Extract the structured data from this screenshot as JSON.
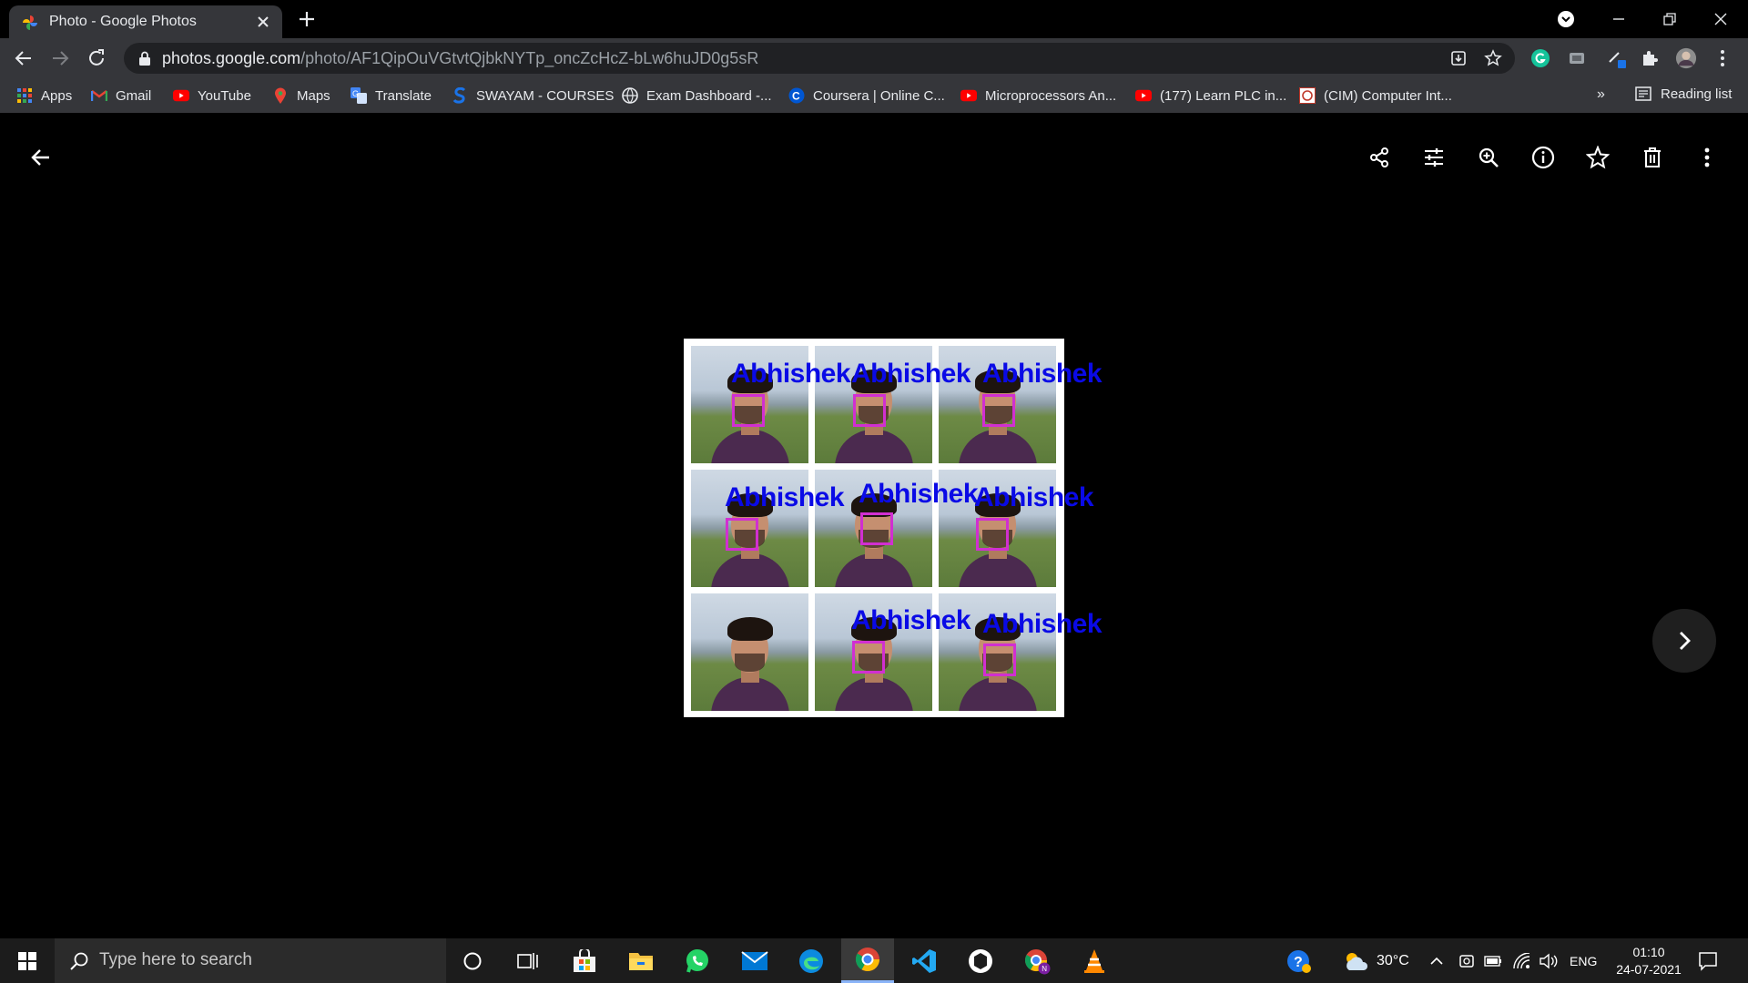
{
  "browser": {
    "tab_title": "Photo - Google Photos",
    "url_domain": "photos.google.com",
    "url_path": "/photo/AF1QipOuVGtvtQjbkNYTp_oncZcHcZ-bLw6huJD0g5sR"
  },
  "bookmarks": [
    {
      "label": "Apps",
      "icon": "apps-grid-icon"
    },
    {
      "label": "Gmail",
      "icon": "gmail-icon"
    },
    {
      "label": "YouTube",
      "icon": "youtube-icon"
    },
    {
      "label": "Maps",
      "icon": "maps-icon"
    },
    {
      "label": "Translate",
      "icon": "translate-icon"
    },
    {
      "label": "SWAYAM - COURSES",
      "icon": "swayam-icon"
    },
    {
      "label": "Exam Dashboard -...",
      "icon": "globe-icon"
    },
    {
      "label": "Coursera | Online C...",
      "icon": "coursera-icon"
    },
    {
      "label": "Microprocessors An...",
      "icon": "youtube-icon"
    },
    {
      "label": "(177) Learn PLC in...",
      "icon": "youtube-icon"
    },
    {
      "label": "(CIM) Computer Int...",
      "icon": "cim-icon"
    }
  ],
  "bookmarks_overflow": "»",
  "reading_list_label": "Reading list",
  "photo": {
    "labels": [
      "Abhishek",
      "Abhishek",
      "Abhishek",
      "Abhishek",
      "Abhishek",
      "Abhishek",
      "Abhishek",
      "Abhishek"
    ]
  },
  "viewer_toolbar": [
    "back-arrow-icon",
    "share-icon",
    "edit-adjust-icon",
    "zoom-in-icon",
    "info-icon",
    "favorite-star-icon",
    "delete-icon",
    "more-options-icon",
    "next-chevron-icon"
  ],
  "taskbar": {
    "search_placeholder": "Type here to search",
    "weather": "30°C",
    "language": "ENG",
    "time": "01:10",
    "date": "24-07-2021"
  },
  "colors": {
    "chrome_toolbar": "#35363a",
    "omnibox": "#202124",
    "label_blue": "#0a0ae6",
    "facebox_magenta": "#d12fd1",
    "taskbar": "#1c1c1c"
  }
}
